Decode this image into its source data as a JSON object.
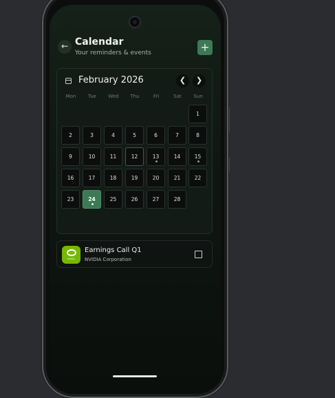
{
  "header": {
    "title": "Calendar",
    "subtitle": "Your reminders & events"
  },
  "calendar": {
    "month_label": "February 2026",
    "weekdays": [
      "Mon",
      "Tue",
      "Wed",
      "Thu",
      "Fri",
      "Sat",
      "Sun"
    ],
    "days": [
      {
        "label": "1",
        "col": 6,
        "row": 0
      },
      {
        "label": "2",
        "col": 0,
        "row": 1
      },
      {
        "label": "3",
        "col": 1,
        "row": 1
      },
      {
        "label": "4",
        "col": 2,
        "row": 1
      },
      {
        "label": "5",
        "col": 3,
        "row": 1
      },
      {
        "label": "6",
        "col": 4,
        "row": 1
      },
      {
        "label": "7",
        "col": 5,
        "row": 1
      },
      {
        "label": "8",
        "col": 6,
        "row": 1
      },
      {
        "label": "9",
        "col": 0,
        "row": 2
      },
      {
        "label": "10",
        "col": 1,
        "row": 2
      },
      {
        "label": "11",
        "col": 2,
        "row": 2
      },
      {
        "label": "12",
        "col": 3,
        "row": 2,
        "outlined": true
      },
      {
        "label": "13",
        "col": 4,
        "row": 2,
        "event": true
      },
      {
        "label": "14",
        "col": 5,
        "row": 2
      },
      {
        "label": "15",
        "col": 6,
        "row": 2,
        "event": true
      },
      {
        "label": "16",
        "col": 0,
        "row": 3
      },
      {
        "label": "17",
        "col": 1,
        "row": 3
      },
      {
        "label": "18",
        "col": 2,
        "row": 3
      },
      {
        "label": "19",
        "col": 3,
        "row": 3
      },
      {
        "label": "20",
        "col": 4,
        "row": 3
      },
      {
        "label": "21",
        "col": 5,
        "row": 3
      },
      {
        "label": "22",
        "col": 6,
        "row": 3
      },
      {
        "label": "23",
        "col": 0,
        "row": 4
      },
      {
        "label": "24",
        "col": 1,
        "row": 4,
        "today": true,
        "event": true
      },
      {
        "label": "25",
        "col": 2,
        "row": 4
      },
      {
        "label": "26",
        "col": 3,
        "row": 4
      },
      {
        "label": "27",
        "col": 4,
        "row": 4
      },
      {
        "label": "28",
        "col": 5,
        "row": 4
      }
    ]
  },
  "events": [
    {
      "title": "Earnings Call Q1",
      "subtitle": "NVIDIA Corporation",
      "logo_text": "NVIDIA",
      "checked": false
    }
  ],
  "colors": {
    "accent": "#3c7a55",
    "logo": "#76b900",
    "background": "#2a2c30"
  },
  "icons": {
    "back": "arrow-left-icon",
    "add": "plus-icon",
    "calendar": "calendar-icon",
    "prev": "chevron-left-icon",
    "next": "chevron-right-icon"
  }
}
